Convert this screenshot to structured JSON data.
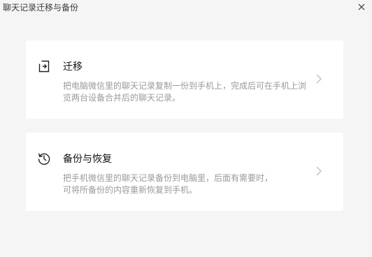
{
  "window": {
    "title": "聊天记录迁移与备份"
  },
  "cards": [
    {
      "title": "迁移",
      "desc_lines": [
        "把电脑微信里的聊天记录复制一份到手机上，完成后可在手机上浏",
        "览两台设备合并后的聊天记录。"
      ],
      "icon": "migrate-icon"
    },
    {
      "title": "备份与恢复",
      "desc_lines": [
        "把手机微信里的聊天记录备份到电脑里，后面有需要时，",
        "可将所备份的内容重新恢复到手机。"
      ],
      "icon": "history-clock-icon"
    }
  ],
  "colors": {
    "background": "#f5f5f5",
    "card": "#ffffff",
    "muted_text": "#9a9a9a"
  }
}
